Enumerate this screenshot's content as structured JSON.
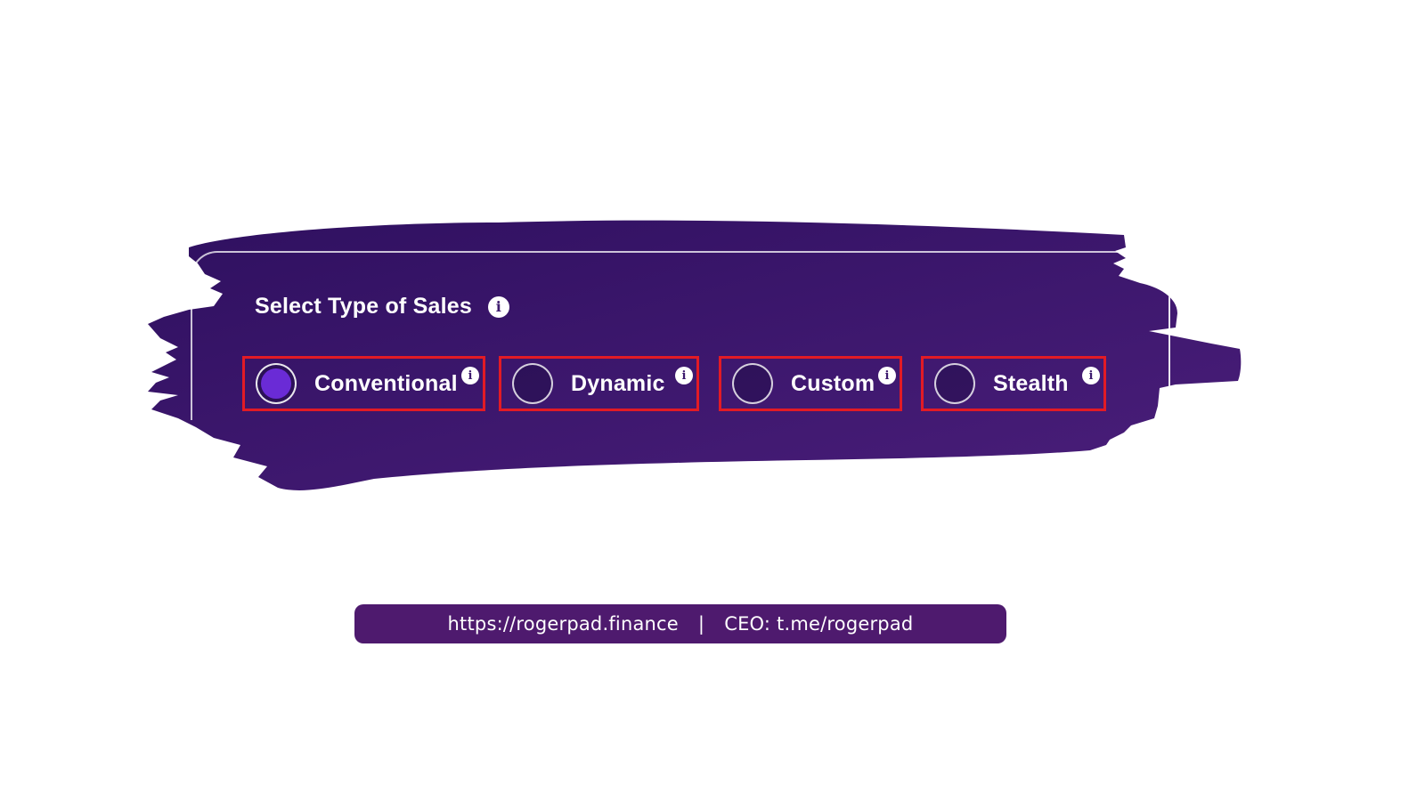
{
  "colors": {
    "brush_purple": "#3e1a6c",
    "brush_purple_light": "#4a1e7a",
    "selected_radio": "#6a2bd6",
    "highlight_border": "#e21b25",
    "footer_bg": "#4e1a6e"
  },
  "panel": {
    "title": "Select Type of Sales",
    "title_icon": "info-icon"
  },
  "sale_types": [
    {
      "label": "Conventional",
      "selected": true,
      "icon": "info-icon"
    },
    {
      "label": "Dynamic",
      "selected": false,
      "icon": "info-icon"
    },
    {
      "label": "Custom",
      "selected": false,
      "icon": "info-icon"
    },
    {
      "label": "Stealth",
      "selected": false,
      "icon": "info-icon"
    }
  ],
  "footer": {
    "website": "https://rogerpad.finance",
    "separator": "|",
    "ceo": "CEO: t.me/rogerpad"
  }
}
